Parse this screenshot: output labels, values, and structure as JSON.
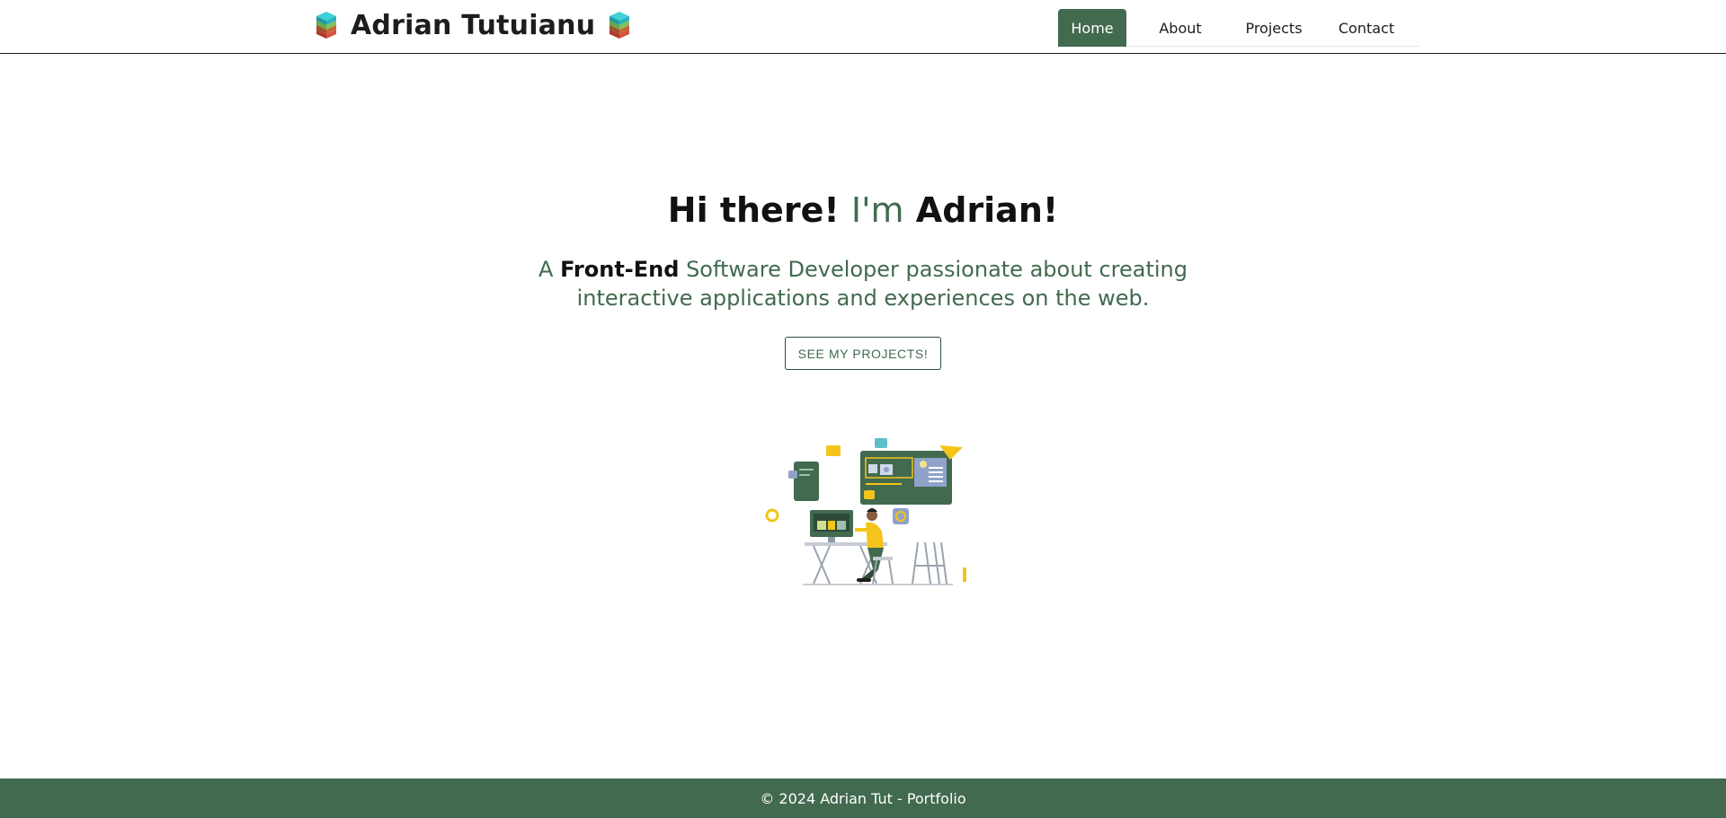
{
  "header": {
    "brand_title": "Adrian Tutuianu",
    "brand_icon": "layered-cube-icon",
    "nav": [
      {
        "label": "Home",
        "active": true
      },
      {
        "label": "About",
        "active": false
      },
      {
        "label": "Projects",
        "active": false
      },
      {
        "label": "Contact",
        "active": false
      }
    ]
  },
  "hero": {
    "title_part1": "Hi there! ",
    "title_accent": "I'm",
    "title_part2": " Adrian!",
    "subtitle_part1": "A ",
    "subtitle_strong": "Front-End",
    "subtitle_part2": " Software Developer passionate about creating interactive applications and experiences on the web.",
    "cta_label": "SEE MY PROJECTS!",
    "illustration": "developer-at-desk-illustration"
  },
  "footer": {
    "text": "© 2024 Adrian Tut - Portfolio"
  },
  "colors": {
    "accent": "#426a4f",
    "text": "#111111",
    "highlight": "#f4c41a"
  }
}
